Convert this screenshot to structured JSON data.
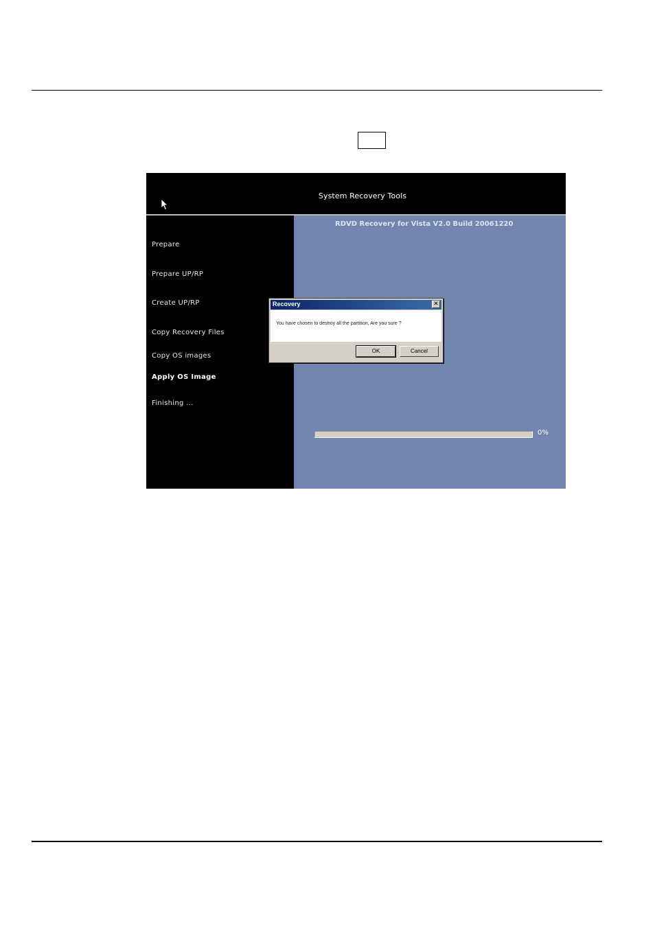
{
  "window": {
    "title": "System Recovery Tools"
  },
  "sidebar": {
    "items": [
      {
        "label": "Prepare"
      },
      {
        "label": "Prepare UP/RP"
      },
      {
        "label": "Create UP/RP"
      },
      {
        "label": "Copy Recovery Files"
      },
      {
        "label": "Copy OS images"
      },
      {
        "label": "Apply OS Image"
      },
      {
        "label": "Finishing ..."
      }
    ],
    "active_item": "Apply OS Image"
  },
  "main": {
    "build_label": "RDVD Recovery for Vista V2.0 Build 20061220",
    "progress": {
      "value": 0,
      "text": "0%"
    }
  },
  "dialog": {
    "title": "Recovery",
    "close_glyph": "✕",
    "message": "You have chosen to destroy all the partition, Are you sure ?",
    "ok_label": "OK",
    "cancel_label": "Cancel"
  },
  "icons": {
    "cursor": "arrow-cursor-icon",
    "close": "close-icon"
  },
  "colors": {
    "panel_blue": "#7285af",
    "background_black": "#000000",
    "dialog_titlebar": "#0a246a"
  }
}
